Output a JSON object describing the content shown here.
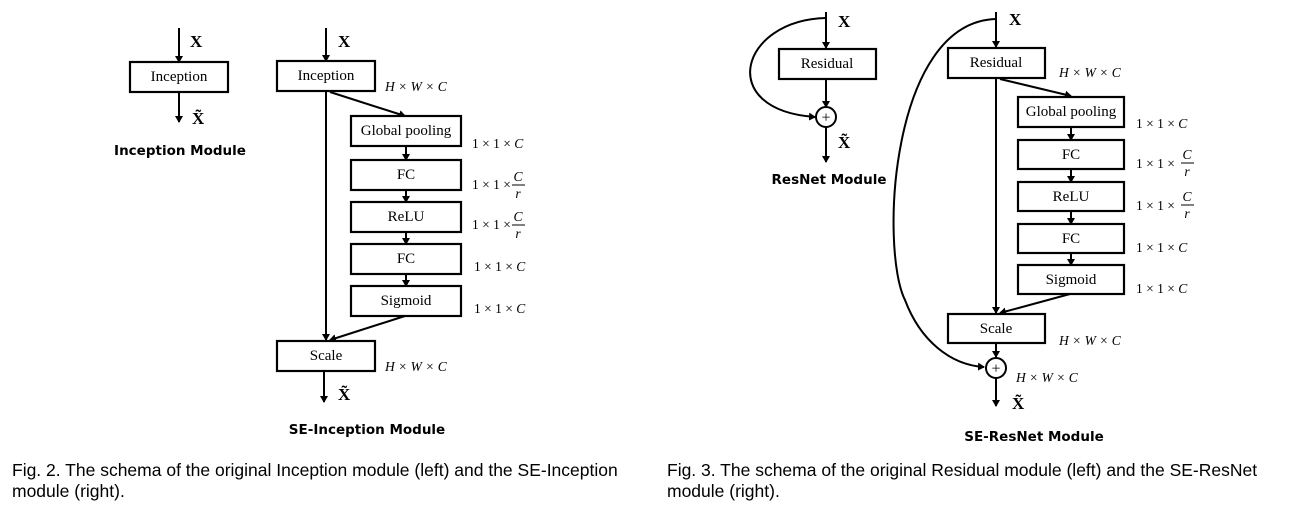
{
  "figure2": {
    "inception_module": {
      "title": "Inception Module",
      "input": "X",
      "output": "X̃",
      "block": "Inception"
    },
    "se_inception_module": {
      "title": "SE-Inception Module",
      "input": "X",
      "output": "X̃",
      "blocks": [
        {
          "label": "Inception",
          "dim": "H × W × C"
        },
        {
          "label": "Global pooling",
          "dim": "1 × 1 × C"
        },
        {
          "label": "FC",
          "dim": "1 × 1 × C/r"
        },
        {
          "label": "ReLU",
          "dim": "1 × 1 × C/r"
        },
        {
          "label": "FC",
          "dim": "1 × 1 × C"
        },
        {
          "label": "Sigmoid",
          "dim": "1 × 1 × C"
        },
        {
          "label": "Scale",
          "dim": "H × W × C"
        }
      ]
    },
    "caption": "Fig. 2. The schema of the original Inception module (left) and the SE-Inception module (right)."
  },
  "figure3": {
    "resnet_module": {
      "title": "ResNet Module",
      "input": "X",
      "output": "X̃",
      "block": "Residual",
      "sum_symbol": "+"
    },
    "se_resnet_module": {
      "title": "SE-ResNet Module",
      "input": "X",
      "output": "X̃",
      "sum_symbol": "+",
      "sum_dim": "H × W × C",
      "blocks": [
        {
          "label": "Residual",
          "dim": "H × W × C"
        },
        {
          "label": "Global pooling",
          "dim": "1 × 1 × C"
        },
        {
          "label": "FC",
          "dim": "1 × 1 × C/r"
        },
        {
          "label": "ReLU",
          "dim": "1 × 1 × C/r"
        },
        {
          "label": "FC",
          "dim": "1 × 1 × C"
        },
        {
          "label": "Sigmoid",
          "dim": "1 × 1 × C"
        },
        {
          "label": "Scale",
          "dim": "H × W × C"
        }
      ]
    },
    "caption": "Fig. 3. The schema of the original Residual module (left) and the SE-ResNet module (right)."
  }
}
